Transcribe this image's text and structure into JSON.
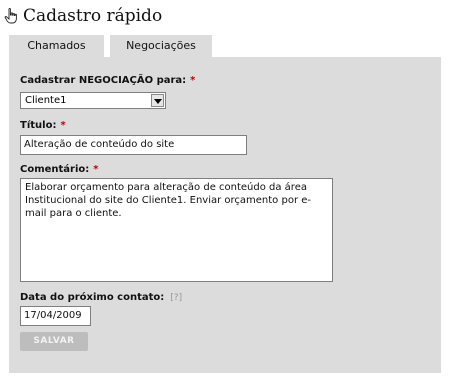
{
  "header": {
    "title": "Cadastro rápido",
    "icon": "hand-pointer-icon"
  },
  "tabs": [
    {
      "label": "Chamados"
    },
    {
      "label": "Negociações"
    }
  ],
  "form": {
    "cliente_label": "Cadastrar NEGOCIAÇÃO para:",
    "cliente_value": "Cliente1",
    "titulo_label": "Título:",
    "titulo_value": "Alteração de conteúdo do site",
    "comentario_label": "Comentário:",
    "comentario_value": "Elaborar orçamento para alteração de conteúdo da área Institucional do site do Cliente1. Enviar orçamento por e-mail para o cliente.",
    "data_label": "Data do próximo contato:",
    "data_help": "[?]",
    "data_value": "17/04/2009",
    "required_marker": "*",
    "save_label": "SALVAR"
  },
  "colors": {
    "panel": "#dcdcdc",
    "required": "#c00000",
    "button": "#bdbdbd"
  }
}
